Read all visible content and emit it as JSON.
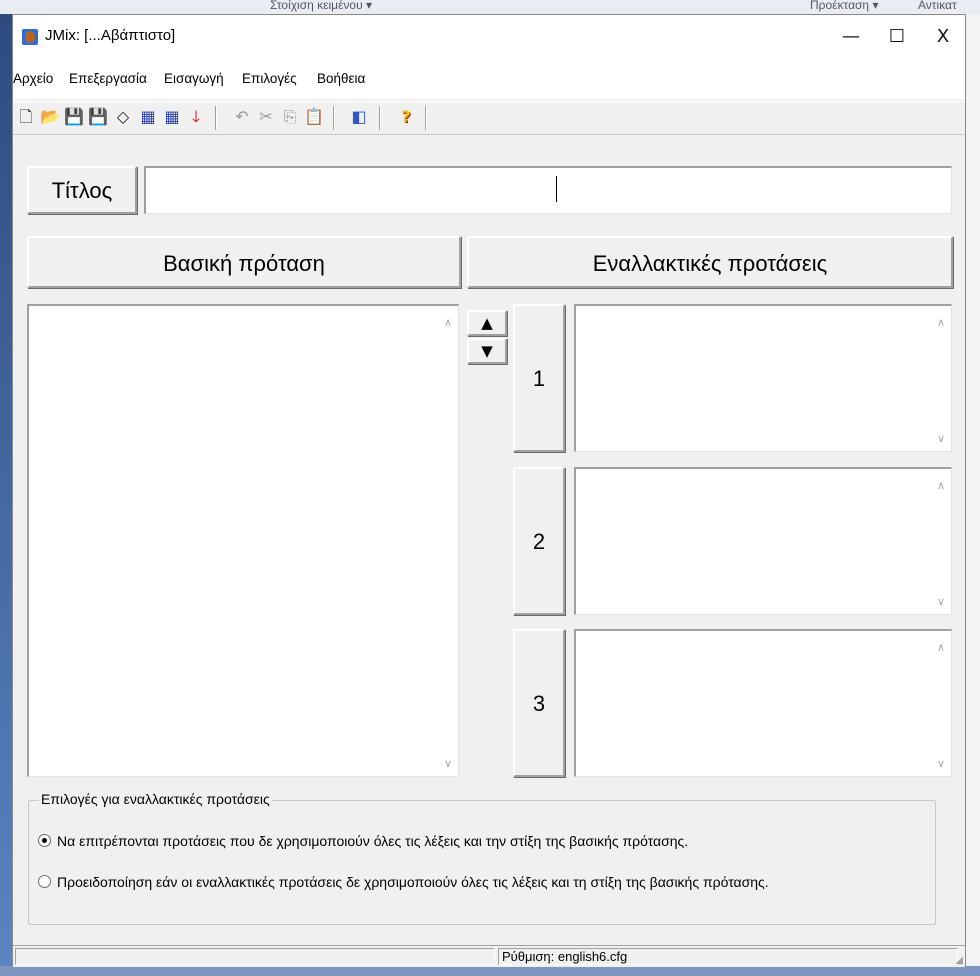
{
  "background": {
    "top_left_text": "Στοίχιση κειμένου ▾",
    "top_right_text1": "Προέκταση ▾",
    "top_right_text2": "Αντικατ"
  },
  "window": {
    "title": "JMix: [...Αβάπτιστο]",
    "controls": {
      "minimize": "—",
      "maximize": "☐",
      "close": "X"
    }
  },
  "menu": {
    "items": [
      {
        "label": "Αρχείο"
      },
      {
        "label": "Επεξεργασία"
      },
      {
        "label": "Εισαγωγή"
      },
      {
        "label": "Επιλογές"
      },
      {
        "label": "Βοήθεια"
      }
    ]
  },
  "toolbar": {
    "buttons": [
      {
        "icon": "new-file-icon",
        "glyph": "🗋"
      },
      {
        "icon": "open-folder-icon",
        "glyph": "📂"
      },
      {
        "icon": "save-icon",
        "glyph": "💾"
      },
      {
        "icon": "save-as-icon",
        "glyph": "💾"
      },
      {
        "icon": "eraser-icon",
        "glyph": "◇"
      },
      {
        "icon": "create-web-page-icon",
        "glyph": "▦"
      },
      {
        "icon": "create-web-page-alt-icon",
        "glyph": "▦"
      },
      {
        "icon": "down-arrow-red-icon",
        "glyph": "🡓"
      },
      {
        "icon": "undo-icon",
        "glyph": "↶"
      },
      {
        "icon": "cut-icon",
        "glyph": "✂"
      },
      {
        "icon": "copy-icon",
        "glyph": "⎘"
      },
      {
        "icon": "paste-icon",
        "glyph": "📋"
      },
      {
        "icon": "configure-icon",
        "glyph": "◧"
      },
      {
        "icon": "help-icon",
        "glyph": "?"
      }
    ]
  },
  "title_field": {
    "label": "Τίτλος",
    "value": ""
  },
  "main_sentence": {
    "header": "Βασική πρόταση",
    "text": ""
  },
  "alternatives": {
    "header": "Εναλλακτικές προτάσεις",
    "move_up": "▲",
    "move_down": "▼",
    "items": [
      {
        "number": "1",
        "text": ""
      },
      {
        "number": "2",
        "text": ""
      },
      {
        "number": "3",
        "text": ""
      }
    ]
  },
  "options": {
    "legend": "Επιλογές για εναλλακτικές προτάσεις",
    "radio1": "Να επιτρέπονται προτάσεις που δε χρησιμοποιούν όλες τις λέξεις και την στίξη της βασικής πρότασης.",
    "radio2": "Προειδοποίηση εάν οι εναλλακτικές προτάσεις δε χρησιμοποιούν όλες τις λέξεις και τη στίξη της βασικής πρότασης.",
    "selected": 1
  },
  "status": {
    "left": "",
    "config": "Ρύθμιση: english6.cfg"
  },
  "colors": {
    "window_bg": "#f0f0f0",
    "desktop_bg": "#3a5f96",
    "help_icon": "#e8c000",
    "arrow_red": "#d21010"
  }
}
